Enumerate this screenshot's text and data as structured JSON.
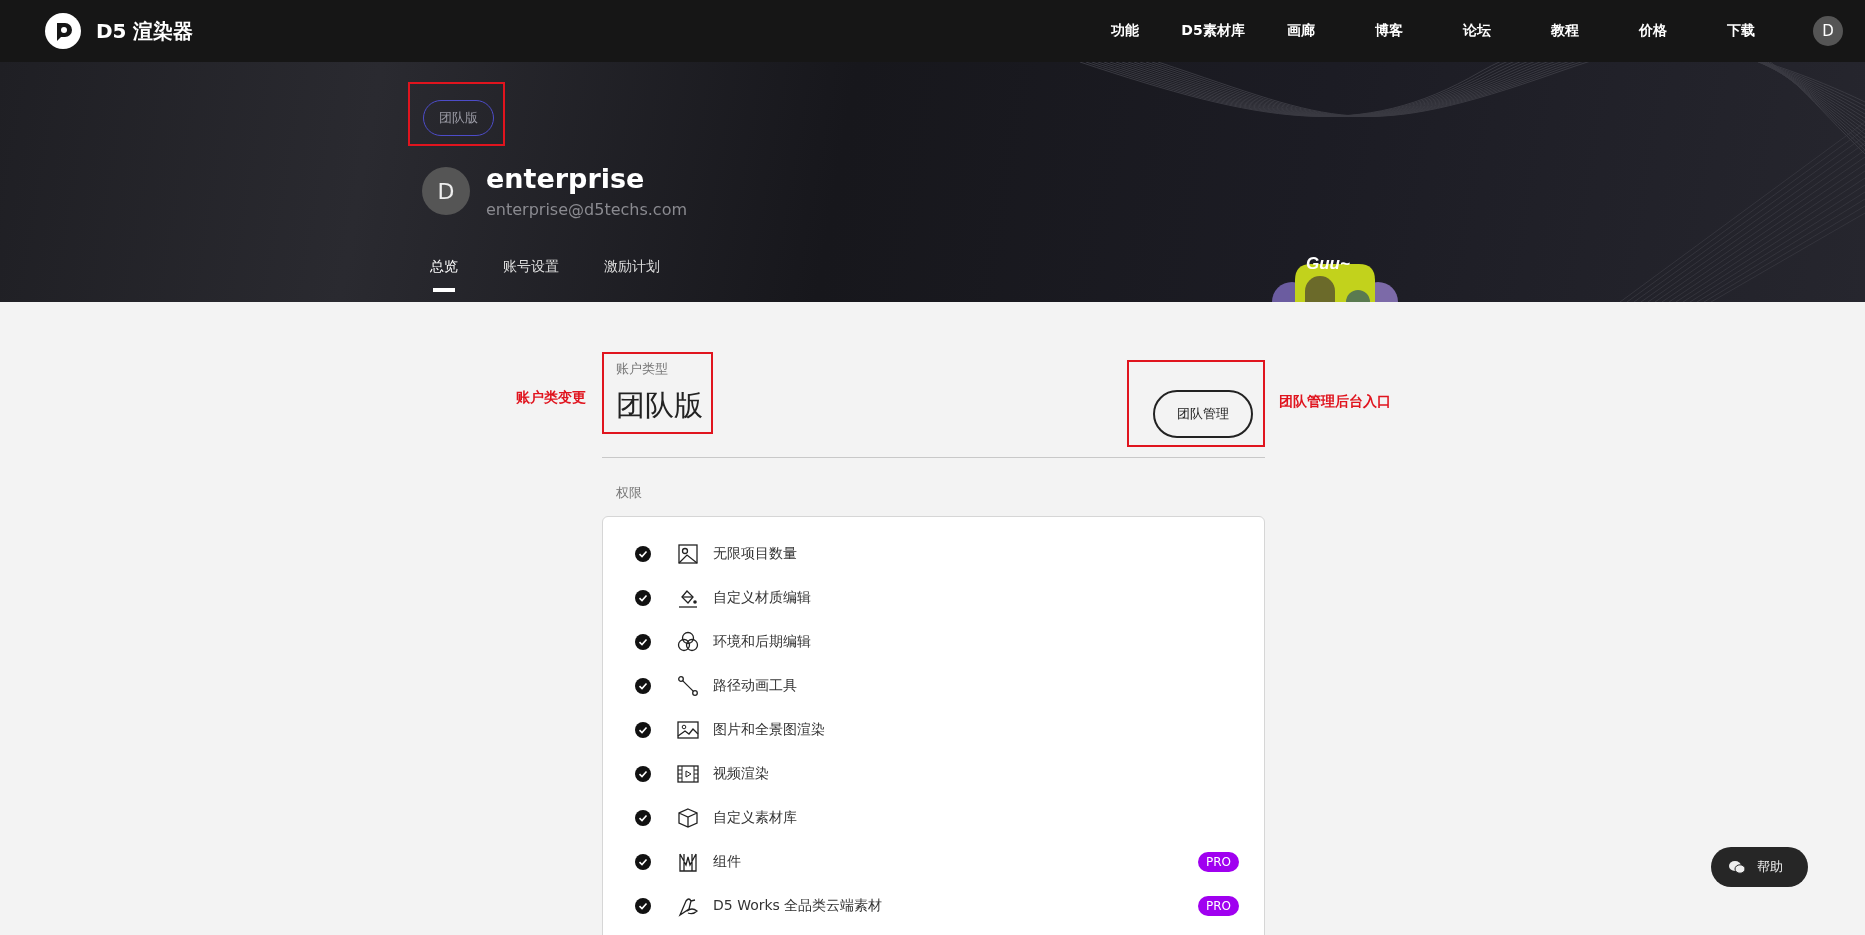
{
  "header": {
    "brand": "D5 渲染器",
    "nav": [
      "功能",
      "D5素材库",
      "画廊",
      "博客",
      "论坛",
      "教程",
      "价格",
      "下载"
    ],
    "avatar_initial": "D"
  },
  "banner": {
    "plan_badge": {
      "label": "团队版",
      "highlighted": true
    },
    "avatar_initial": "D",
    "name": "enterprise",
    "email": "enterprise@d5techs.com",
    "tabs": [
      {
        "label": "总览",
        "selected": true
      },
      {
        "label": "账号设置",
        "selected": false
      },
      {
        "label": "激励计划",
        "selected": false
      }
    ],
    "mascot_caption": "Guu~"
  },
  "account": {
    "annotation_left": "账户类变更",
    "type_label": "账户类型",
    "type_value": "团队版",
    "type_highlighted": true,
    "manage_button": "团队管理",
    "manage_highlighted": true,
    "annotation_right": "团队管理后台入口"
  },
  "permissions": {
    "title": "权限",
    "items": [
      {
        "label": "无限项目数量",
        "checked": true,
        "pro": false
      },
      {
        "label": "自定义材质编辑",
        "checked": true,
        "pro": false
      },
      {
        "label": "环境和后期编辑",
        "checked": true,
        "pro": false
      },
      {
        "label": "路径动画工具",
        "checked": true,
        "pro": false
      },
      {
        "label": "图片和全景图渲染",
        "checked": true,
        "pro": false
      },
      {
        "label": "视频渲染",
        "checked": true,
        "pro": false
      },
      {
        "label": "自定义素材库",
        "checked": true,
        "pro": false
      },
      {
        "label": "组件",
        "checked": true,
        "pro": true,
        "badge": "PRO"
      },
      {
        "label": "D5 Works 全品类云端素材",
        "checked": true,
        "pro": true,
        "badge": "PRO"
      }
    ]
  },
  "help_button": "帮助"
}
